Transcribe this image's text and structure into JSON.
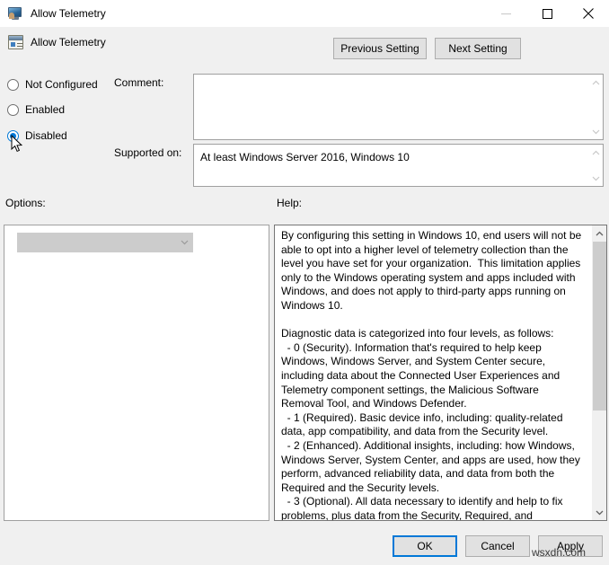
{
  "window": {
    "title": "Allow Telemetry",
    "icon": "computer-monitor-icon",
    "controls": {
      "minimize": "minimize-icon",
      "maximize": "maximize-icon",
      "close": "close-icon"
    }
  },
  "header": {
    "policy_name": "Allow Telemetry",
    "icon": "policy-setting-icon",
    "previous_button": "Previous Setting",
    "next_button": "Next Setting"
  },
  "state": {
    "options": [
      {
        "label": "Not Configured",
        "selected": false
      },
      {
        "label": "Enabled",
        "selected": false
      },
      {
        "label": "Disabled",
        "selected": true
      }
    ]
  },
  "comment": {
    "label": "Comment:",
    "value": "",
    "placeholder": ""
  },
  "supported_on": {
    "label": "Supported on:",
    "value": "At least Windows Server 2016, Windows 10"
  },
  "options_panel": {
    "label": "Options:",
    "combo": {
      "value": "",
      "enabled": false,
      "arrow_icon": "chevron-down-icon"
    }
  },
  "help_panel": {
    "label": "Help:",
    "text": "By configuring this setting in Windows 10, end users will not be able to opt into a higher level of telemetry collection than the level you have set for your organization.  This limitation applies only to the Windows operating system and apps included with Windows, and does not apply to third-party apps running on Windows 10.\n\nDiagnostic data is categorized into four levels, as follows:\n  - 0 (Security). Information that's required to help keep Windows, Windows Server, and System Center secure, including data about the Connected User Experiences and Telemetry component settings, the Malicious Software Removal Tool, and Windows Defender.\n  - 1 (Required). Basic device info, including: quality-related data, app compatibility, and data from the Security level.\n  - 2 (Enhanced). Additional insights, including: how Windows, Windows Server, System Center, and apps are used, how they perform, advanced reliability data, and data from both the Required and the Security levels.\n  - 3 (Optional). All data necessary to identify and help to fix problems, plus data from the Security, Required, and Enhanced levels.",
    "scrollbar": {
      "up_icon": "chevron-up-icon",
      "down_icon": "chevron-down-icon"
    }
  },
  "footer": {
    "ok": "OK",
    "cancel": "Cancel",
    "apply": "Apply"
  },
  "watermark": "wsxdn.com",
  "colors": {
    "accent": "#0078d7",
    "dialog_bg": "#f0f0f0",
    "button_bg": "#e1e1e1",
    "button_border": "#adadad",
    "field_bg": "#ffffff",
    "field_border": "#a0a0a0",
    "disabled_combo": "#cccccc",
    "scroll_thumb": "#cdcdcd"
  }
}
